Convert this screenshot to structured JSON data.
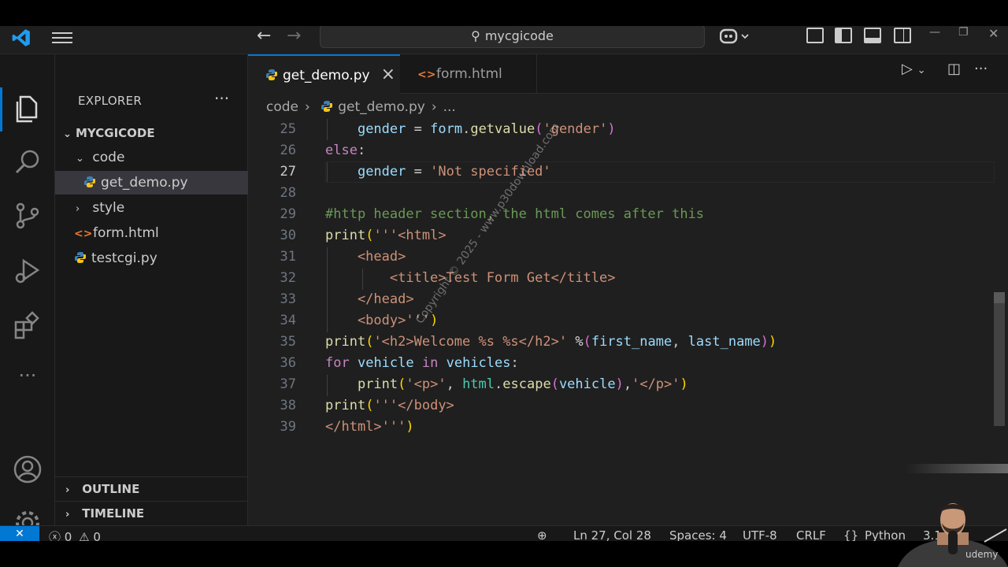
{
  "titlebar": {
    "search_text": "mycgicode"
  },
  "sidebar": {
    "title": "EXPLORER",
    "root": "MYCGICODE",
    "items": [
      {
        "label": "code",
        "kind": "folder-open"
      },
      {
        "label": "get_demo.py",
        "kind": "python"
      },
      {
        "label": "style",
        "kind": "folder-closed"
      },
      {
        "label": "form.html",
        "kind": "html"
      },
      {
        "label": "testcgi.py",
        "kind": "python"
      }
    ],
    "outline": "OUTLINE",
    "timeline": "TIMELINE"
  },
  "tabs": [
    {
      "label": "get_demo.py",
      "active": true
    },
    {
      "label": "form.html",
      "active": false
    }
  ],
  "breadcrumb": {
    "folder": "code",
    "file": "get_demo.py",
    "more": "..."
  },
  "editor": {
    "current_line": 27,
    "line_numbers": [
      "25",
      "26",
      "27",
      "28",
      "29",
      "30",
      "31",
      "32",
      "33",
      "34",
      "35",
      "36",
      "37",
      "38",
      "39"
    ]
  },
  "status": {
    "errors": "0",
    "warnings": "0",
    "position": "Ln 27, Col 28",
    "spaces": "Spaces: 4",
    "encoding": "UTF-8",
    "eol": "CRLF",
    "language": "Python",
    "version": "3.1"
  },
  "watermark": "Copyright © 2025 - www.p30download.com",
  "overlay": {
    "udemy": "udemy"
  },
  "colors": {
    "accent": "#0078d4",
    "editor_bg": "#1f1f1f",
    "keyword": "#c586c0",
    "variable": "#9cdcfe",
    "function": "#dcdcaa",
    "string": "#ce9178",
    "comment": "#6a9955"
  }
}
